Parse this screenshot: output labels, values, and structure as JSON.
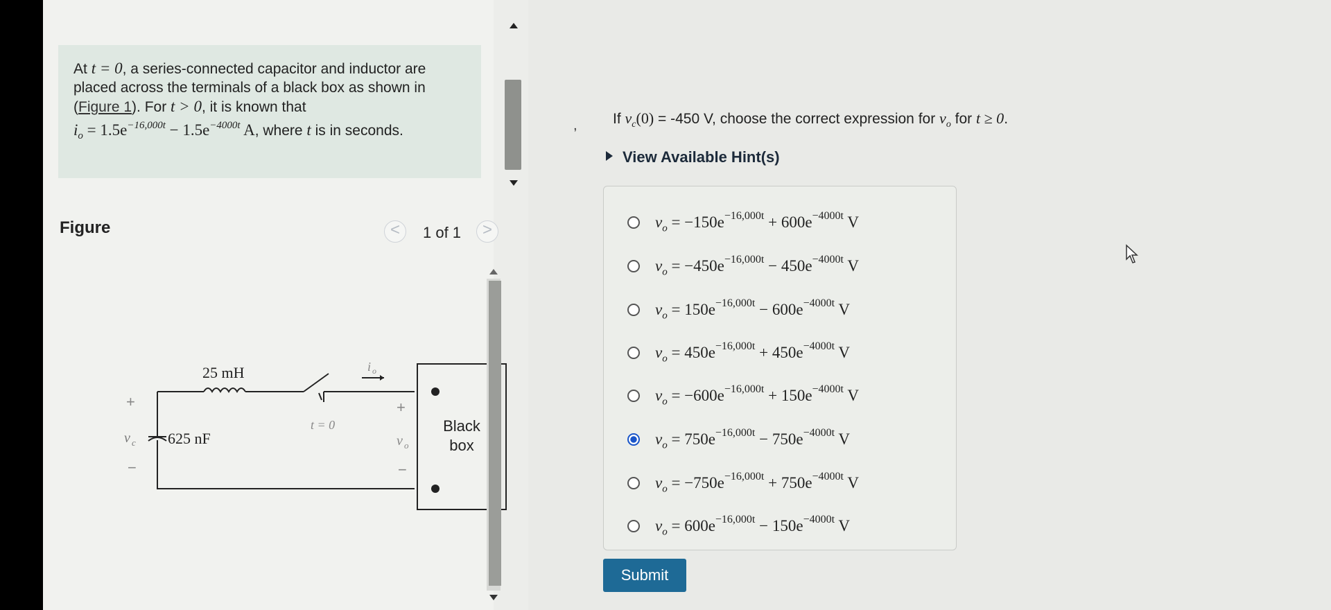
{
  "problem": {
    "p1": "At ",
    "m1": "t = 0",
    "p2": ", a series-connected capacitor and inductor are placed across the terminals of a black box as shown in (",
    "link": "Figure 1",
    "p3": "). For ",
    "m2": "t > 0",
    "p4": ", it is known that",
    "io": "i",
    "io_sub": "o",
    "eq_a": " = 1.5e",
    "exp_a": "−16,000t",
    "eq_b": " − 1.5e",
    "exp_b": "−4000t",
    "unit": " A",
    "p5": ", where ",
    "m3": "t",
    "p6": " is in seconds."
  },
  "figure": {
    "title": "Figure",
    "pager": "1 of 1",
    "prev": "<",
    "next": ">",
    "labels": {
      "inductor": "25 mH",
      "capacitor": "625 nF",
      "vc": "v",
      "vc_sub": "c",
      "switch": "t = 0",
      "io": "i",
      "io_sub": "o",
      "vo": "v",
      "vo_sub": "o",
      "plus_left": "+",
      "minus_left": "−",
      "plus_right": "+",
      "minus_right": "−",
      "box_line1": "Black",
      "box_line2": "box"
    }
  },
  "question": {
    "pre": "If ",
    "vc": "v",
    "vc_sub": "c",
    "vc_arg": "(0)",
    "val": " = -450 V",
    "mid": ", choose the correct expression for ",
    "vo": "v",
    "vo_sub": "o",
    "for": " for ",
    "cond": "t ≥ 0",
    "end": "."
  },
  "comma": ",",
  "hint": "View Available Hint(s)",
  "options": [
    {
      "lhs": "v",
      "sub": "o",
      "c1": " = −150e",
      "e1": "−16,000t",
      "c2": " + 600e",
      "e2": "−4000t",
      "u": " V",
      "selected": false
    },
    {
      "lhs": "v",
      "sub": "o",
      "c1": " = −450e",
      "e1": "−16,000t",
      "c2": " − 450e",
      "e2": "−4000t",
      "u": " V",
      "selected": false
    },
    {
      "lhs": "v",
      "sub": "o",
      "c1": " = 150e",
      "e1": "−16,000t",
      "c2": " − 600e",
      "e2": "−4000t",
      "u": " V",
      "selected": false
    },
    {
      "lhs": "v",
      "sub": "o",
      "c1": " = 450e",
      "e1": "−16,000t",
      "c2": " + 450e",
      "e2": "−4000t",
      "u": " V",
      "selected": false
    },
    {
      "lhs": "v",
      "sub": "o",
      "c1": " = −600e",
      "e1": "−16,000t",
      "c2": " + 150e",
      "e2": "−4000t",
      "u": " V",
      "selected": false
    },
    {
      "lhs": "v",
      "sub": "o",
      "c1": " = 750e",
      "e1": "−16,000t",
      "c2": " − 750e",
      "e2": "−4000t",
      "u": " V",
      "selected": true
    },
    {
      "lhs": "v",
      "sub": "o",
      "c1": " = −750e",
      "e1": "−16,000t",
      "c2": " + 750e",
      "e2": "−4000t",
      "u": " V",
      "selected": false
    },
    {
      "lhs": "v",
      "sub": "o",
      "c1": " = 600e",
      "e1": "−16,000t",
      "c2": " − 150e",
      "e2": "−4000t",
      "u": " V",
      "selected": false
    }
  ],
  "submit": "Submit",
  "colors": {
    "submit_bg": "#1e6a96",
    "radio_selected": "#1a55c9",
    "problem_bg": "#dfe8e2"
  }
}
